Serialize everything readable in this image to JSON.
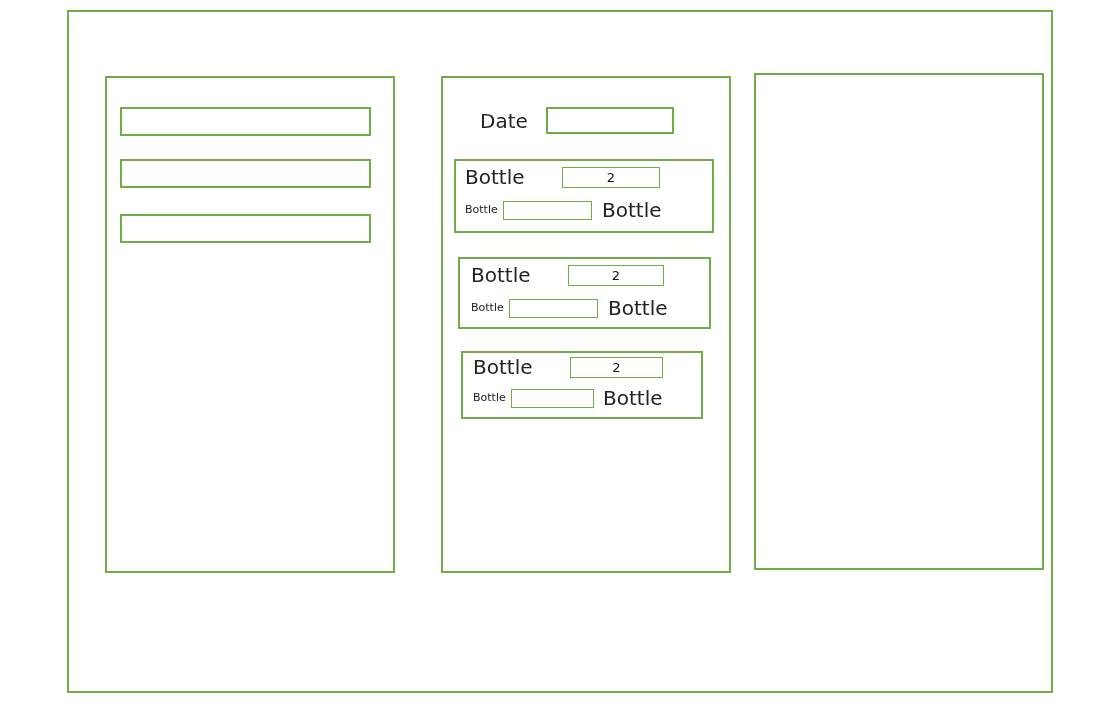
{
  "panels": [
    {
      "kind": "field_list",
      "fields": [
        {
          "kind": "input"
        },
        {
          "kind": "input"
        },
        {
          "kind": "input"
        }
      ]
    },
    {
      "kind": "bottle_form",
      "date": {
        "label": "Date"
      },
      "bottles": [
        {
          "title": "Bottle",
          "quantity": "2",
          "field_label": "Bottle",
          "unit": "Bottle"
        },
        {
          "title": "Bottle",
          "quantity": "2",
          "field_label": "Bottle",
          "unit": "Bottle"
        },
        {
          "title": "Bottle",
          "quantity": "2",
          "field_label": "Bottle",
          "unit": "Bottle"
        }
      ]
    },
    {
      "kind": "blank"
    }
  ]
}
